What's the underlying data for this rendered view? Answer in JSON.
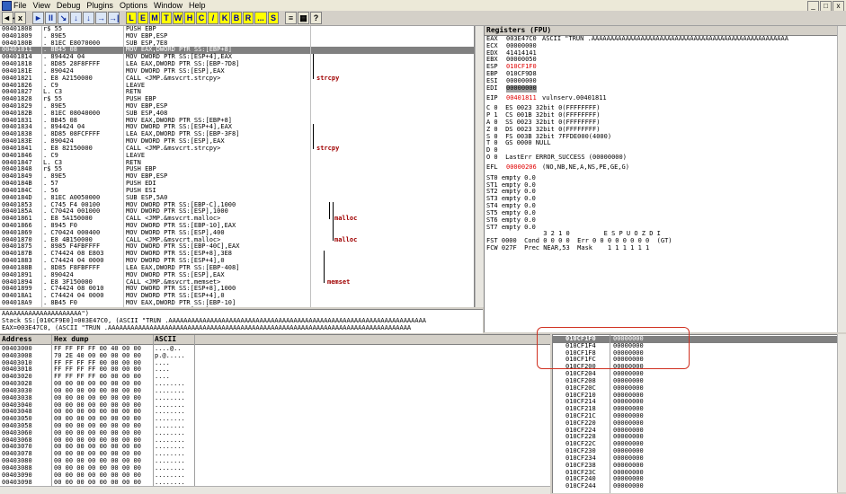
{
  "menu": {
    "items": [
      "File",
      "View",
      "Debug",
      "Plugins",
      "Options",
      "Window",
      "Help"
    ]
  },
  "window_controls": [
    "_",
    "□",
    "x"
  ],
  "toolbar": {
    "left_buttons": [
      "◄◄",
      "x"
    ],
    "blue_buttons": [
      "►",
      "II",
      "↘",
      "↓",
      "↓",
      "→",
      "→|"
    ],
    "letter_buttons": [
      "L",
      "E",
      "M",
      "T",
      "W",
      "H",
      "C",
      "/",
      "K",
      "B",
      "R",
      "...",
      "S"
    ],
    "right_buttons": [
      "≡",
      "▦",
      "?"
    ]
  },
  "disasm": {
    "rows": [
      {
        "addr": "00401808",
        "hex": "r$ 55",
        "asm": "PUSH EBP",
        "cmt": ""
      },
      {
        "addr": "00401809",
        "hex": ". 89E5",
        "asm": "MOV EBP,ESP",
        "cmt": ""
      },
      {
        "addr": "0040180B",
        "hex": ". 81EC E8070000",
        "asm": "SUB ESP,7E8",
        "cmt": ""
      },
      {
        "addr": "00401811",
        "hex": ". 8B45 08",
        "asm": "MOV EAX,DWORD PTR SS:[EBP+8]",
        "cmt": ""
      },
      {
        "addr": "00401814",
        "hex": ". 894424 04",
        "asm": "MOV DWORD PTR SS:[ESP+4],EAX",
        "cmt": ""
      },
      {
        "addr": "00401818",
        "hex": ". 8D85 28F8FFFF",
        "asm": "LEA EAX,DWORD PTR SS:[EBP-7D8]",
        "cmt": ""
      },
      {
        "addr": "0040181E",
        "hex": ". 890424",
        "asm": "MOV DWORD PTR SS:[ESP],EAX",
        "cmt": ""
      },
      {
        "addr": "00401821",
        "hex": ". E8 A2150000",
        "asm": "CALL <JMP.&msvcrt.strcpy>",
        "cmt": "strcpy"
      },
      {
        "addr": "00401826",
        "hex": ". C9",
        "asm": "LEAVE",
        "cmt": ""
      },
      {
        "addr": "00401827",
        "hex": "L. C3",
        "asm": "RETN",
        "cmt": ""
      },
      {
        "addr": "00401828",
        "hex": "r$ 55",
        "asm": "PUSH EBP",
        "cmt": ""
      },
      {
        "addr": "00401829",
        "hex": ". 89E5",
        "asm": "MOV EBP,ESP",
        "cmt": ""
      },
      {
        "addr": "0040182B",
        "hex": ". 81EC 08040000",
        "asm": "SUB ESP,408",
        "cmt": ""
      },
      {
        "addr": "00401831",
        "hex": ". 8B45 08",
        "asm": "MOV EAX,DWORD PTR SS:[EBP+8]",
        "cmt": ""
      },
      {
        "addr": "00401834",
        "hex": ". 894424 04",
        "asm": "MOV DWORD PTR SS:[ESP+4],EAX",
        "cmt": ""
      },
      {
        "addr": "00401838",
        "hex": ". 8D85 08FCFFFF",
        "asm": "LEA EAX,DWORD PTR SS:[EBP-3F8]",
        "cmt": ""
      },
      {
        "addr": "0040183E",
        "hex": ". 890424",
        "asm": "MOV DWORD PTR SS:[ESP],EAX",
        "cmt": ""
      },
      {
        "addr": "00401841",
        "hex": ". E8 82150000",
        "asm": "CALL <JMP.&msvcrt.strcpy>",
        "cmt": "strcpy"
      },
      {
        "addr": "00401846",
        "hex": ". C9",
        "asm": "LEAVE",
        "cmt": ""
      },
      {
        "addr": "00401847",
        "hex": "L. C3",
        "asm": "RETN",
        "cmt": ""
      },
      {
        "addr": "00401848",
        "hex": "r$ 55",
        "asm": "PUSH EBP",
        "cmt": ""
      },
      {
        "addr": "00401849",
        "hex": ". 89E5",
        "asm": "MOV EBP,ESP",
        "cmt": ""
      },
      {
        "addr": "0040184B",
        "hex": ". 57",
        "asm": "PUSH EDI",
        "cmt": ""
      },
      {
        "addr": "0040184C",
        "hex": ". 56",
        "asm": "PUSH ESI",
        "cmt": ""
      },
      {
        "addr": "0040184D",
        "hex": ". 81EC A0050000",
        "asm": "SUB ESP,5A0",
        "cmt": ""
      },
      {
        "addr": "00401853",
        "hex": ". C745 F4 00100",
        "asm": "MOV DWORD PTR SS:[EBP-C],1000",
        "cmt": ""
      },
      {
        "addr": "0040185A",
        "hex": ". C70424 001000",
        "asm": "MOV DWORD PTR SS:[ESP],1000",
        "cmt": ""
      },
      {
        "addr": "00401861",
        "hex": ". E8 5A150000",
        "asm": "CALL <JMP.&msvcrt.malloc>",
        "cmt": "malloc"
      },
      {
        "addr": "00401866",
        "hex": ". 8945 F0",
        "asm": "MOV DWORD PTR SS:[EBP-10],EAX",
        "cmt": ""
      },
      {
        "addr": "00401869",
        "hex": ". C70424 000400",
        "asm": "MOV DWORD PTR SS:[ESP],400",
        "cmt": ""
      },
      {
        "addr": "00401870",
        "hex": ". E8 4B150000",
        "asm": "CALL <JMP.&msvcrt.malloc>",
        "cmt": "malloc"
      },
      {
        "addr": "00401875",
        "hex": ". 8985 F4FBFFFF",
        "asm": "MOV DWORD PTR SS:[EBP-40C],EAX",
        "cmt": ""
      },
      {
        "addr": "0040187B",
        "hex": ". C74424 08 E803",
        "asm": "MOV DWORD PTR SS:[ESP+8],3E8",
        "cmt": ""
      },
      {
        "addr": "00401883",
        "hex": ". C74424 04 0000",
        "asm": "MOV DWORD PTR SS:[ESP+4],0",
        "cmt": ""
      },
      {
        "addr": "0040188B",
        "hex": ". 8D85 F8FBFFFF",
        "asm": "LEA EAX,DWORD PTR SS:[EBP-408]",
        "cmt": ""
      },
      {
        "addr": "00401891",
        "hex": ". 890424",
        "asm": "MOV DWORD PTR SS:[ESP],EAX",
        "cmt": ""
      },
      {
        "addr": "00401894",
        "hex": ". E8 3F150000",
        "asm": "CALL <JMP.&msvcrt.memset>",
        "cmt": "memset"
      },
      {
        "addr": "00401899",
        "hex": ". C74424 08 0010",
        "asm": "MOV DWORD PTR SS:[ESP+8],1000",
        "cmt": ""
      },
      {
        "addr": "004018A1",
        "hex": ". C74424 04 0000",
        "asm": "MOV DWORD PTR SS:[ESP+4],0",
        "cmt": ""
      },
      {
        "addr": "004018A9",
        "hex": ". 8B45 F0",
        "asm": "MOV EAX,DWORD PTR SS:[EBP-10]",
        "cmt": ""
      },
      {
        "addr": "004018AC",
        "hex": ". 890424",
        "asm": "MOV DWORD PTR SS:[ESP],EAX",
        "cmt": ""
      }
    ],
    "selected_index": 3
  },
  "info": {
    "lines": [
      "AAAAAAAAAAAAAAAAAAAAA\")",
      "Stack SS:[010CF9E0]=003E47C0, (ASCII \"TRUN .AAAAAAAAAAAAAAAAAAAAAAAAAAAAAAAAAAAAAAAAAAAAAAAAAAAAAAAAAAAAAAAAAAAA",
      "EAX=003E47C0, (ASCII \"TRUN .AAAAAAAAAAAAAAAAAAAAAAAAAAAAAAAAAAAAAAAAAAAAAAAAAAAAAAAAAAAAAAAAAAAAAAAAAAAAAAAA"
    ]
  },
  "registers": {
    "title": "Registers (FPU)",
    "rows": [
      {
        "name": "EAX",
        "val": "003E47C0",
        "cmt": "ASCII \"TRUN .AAAAAAAAAAAAAAAAAAAAAAAAAAAAAAAAAAAAAAAAAAAAAAAAAAAA",
        "hl": false
      },
      {
        "name": "ECX",
        "val": "00000000",
        "cmt": "",
        "hl": false
      },
      {
        "name": "EDX",
        "val": "41414141",
        "cmt": "",
        "hl": false
      },
      {
        "name": "EBX",
        "val": "00000050",
        "cmt": "",
        "hl": false
      },
      {
        "name": "ESP",
        "val": "010CF1F0",
        "cmt": "",
        "hl": true
      },
      {
        "name": "EBP",
        "val": "010CF9D8",
        "cmt": "",
        "hl": false
      },
      {
        "name": "ESI",
        "val": "00000000",
        "cmt": "",
        "hl": false
      },
      {
        "name": "EDI",
        "val": "00000000",
        "cmt": "",
        "hl": false
      }
    ],
    "eip": {
      "name": "EIP",
      "val": "00401811",
      "cmt": "vulnserv.00401811"
    },
    "flags": [
      "C 0  ES 0023 32bit 0(FFFFFFFF)",
      "P 1  CS 001B 32bit 0(FFFFFFFF)",
      "A 0  SS 0023 32bit 0(FFFFFFFF)",
      "Z 0  DS 0023 32bit 0(FFFFFFFF)",
      "S 0  FS 003B 32bit 7FFDE000(4000)",
      "T 0  GS 0000 NULL",
      "D 0",
      "O 0  LastErr ERROR_SUCCESS (00000000)"
    ],
    "efl": {
      "name": "EFL",
      "val": "00000206",
      "cmt": "(NO,NB,NE,A,NS,PE,GE,G)"
    },
    "fpu": [
      "ST0 empty 0.0",
      "ST1 empty 0.0",
      "ST2 empty 0.0",
      "ST3 empty 0.0",
      "ST4 empty 0.0",
      "ST5 empty 0.0",
      "ST6 empty 0.0",
      "ST7 empty 0.0"
    ],
    "fpu_hdr": "               3 2 1 0         E S P U O Z D I",
    "fst": "FST 0000  Cond 0 0 0 0  Err 0 0 0 0 0 0 0 0  (GT)",
    "fcw": "FCW 027F  Prec NEAR,53  Mask    1 1 1 1 1 1"
  },
  "dump": {
    "headers": [
      "Address",
      "Hex dump",
      "ASCII"
    ],
    "rows": [
      {
        "addr": "00403000",
        "hex": "FF FF FF FF 00 40 00 00",
        "ascii": "....@.."
      },
      {
        "addr": "00403008",
        "hex": "70 2E 40 00 00 00 00 00",
        "ascii": "p.@....."
      },
      {
        "addr": "00403010",
        "hex": "FF FF FF FF 00 00 00 00",
        "ascii": "...."
      },
      {
        "addr": "00403018",
        "hex": "FF FF FF FF 00 00 00 00",
        "ascii": "...."
      },
      {
        "addr": "00403020",
        "hex": "FF FF FF FF 00 00 00 00",
        "ascii": "...."
      },
      {
        "addr": "00403028",
        "hex": "00 00 00 00 00 00 00 00",
        "ascii": "........"
      },
      {
        "addr": "00403030",
        "hex": "00 00 00 00 00 00 00 00",
        "ascii": "........"
      },
      {
        "addr": "00403038",
        "hex": "00 00 00 00 00 00 00 00",
        "ascii": "........"
      },
      {
        "addr": "00403040",
        "hex": "00 00 00 00 00 00 00 00",
        "ascii": "........"
      },
      {
        "addr": "00403048",
        "hex": "00 00 00 00 00 00 00 00",
        "ascii": "........"
      },
      {
        "addr": "00403050",
        "hex": "00 00 00 00 00 00 00 00",
        "ascii": "........"
      },
      {
        "addr": "00403058",
        "hex": "00 00 00 00 00 00 00 00",
        "ascii": "........"
      },
      {
        "addr": "00403060",
        "hex": "00 00 00 00 00 00 00 00",
        "ascii": "........"
      },
      {
        "addr": "00403068",
        "hex": "00 00 00 00 00 00 00 00",
        "ascii": "........"
      },
      {
        "addr": "00403070",
        "hex": "00 00 00 00 00 00 00 00",
        "ascii": "........"
      },
      {
        "addr": "00403078",
        "hex": "00 00 00 00 00 00 00 00",
        "ascii": "........"
      },
      {
        "addr": "00403080",
        "hex": "00 00 00 00 00 00 00 00",
        "ascii": "........"
      },
      {
        "addr": "00403088",
        "hex": "00 00 00 00 00 00 00 00",
        "ascii": "........"
      },
      {
        "addr": "00403090",
        "hex": "00 00 00 00 00 00 00 00",
        "ascii": "........"
      },
      {
        "addr": "00403098",
        "hex": "00 00 00 00 00 00 00 00",
        "ascii": "........"
      }
    ]
  },
  "stack": {
    "rows": [
      {
        "addr": "010CF1F0",
        "val": "00000000"
      },
      {
        "addr": "010CF1F4",
        "val": "00000000"
      },
      {
        "addr": "010CF1F8",
        "val": "00000000"
      },
      {
        "addr": "010CF1FC",
        "val": "00000000"
      },
      {
        "addr": "010CF200",
        "val": "00000000"
      },
      {
        "addr": "010CF204",
        "val": "00000000"
      },
      {
        "addr": "010CF208",
        "val": "00000000"
      },
      {
        "addr": "010CF20C",
        "val": "00000000"
      },
      {
        "addr": "010CF210",
        "val": "00000000"
      },
      {
        "addr": "010CF214",
        "val": "00000000"
      },
      {
        "addr": "010CF218",
        "val": "00000000"
      },
      {
        "addr": "010CF21C",
        "val": "00000000"
      },
      {
        "addr": "010CF220",
        "val": "00000000"
      },
      {
        "addr": "010CF224",
        "val": "00000000"
      },
      {
        "addr": "010CF228",
        "val": "00000000"
      },
      {
        "addr": "010CF22C",
        "val": "00000000"
      },
      {
        "addr": "010CF230",
        "val": "00000000"
      },
      {
        "addr": "010CF234",
        "val": "00000000"
      },
      {
        "addr": "010CF238",
        "val": "00000000"
      },
      {
        "addr": "010CF23C",
        "val": "00000000"
      },
      {
        "addr": "010CF240",
        "val": "00000000"
      },
      {
        "addr": "010CF244",
        "val": "00000000"
      }
    ],
    "highlight_count": 5
  },
  "colors": {
    "accent_red": "#e00000",
    "highlight_box": "#d03020",
    "selected": "#808080"
  }
}
